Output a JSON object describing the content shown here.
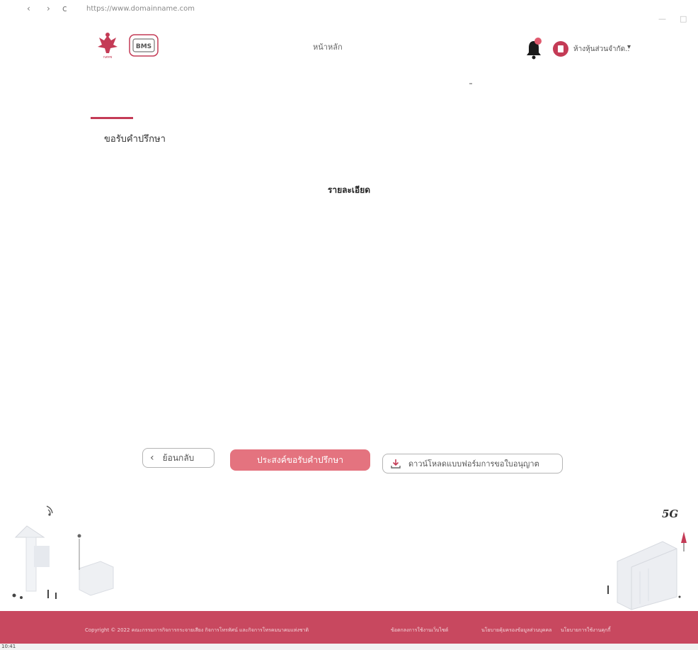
{
  "browser": {
    "back_glyph": "‹",
    "forward_glyph": "›",
    "reload_glyph": "c",
    "url": "https://www.domainname.com",
    "minimize_glyph": "—",
    "restore_glyph": "□"
  },
  "header": {
    "nav_home": "หน้าหลัก",
    "user_name": "ห้างหุ้นส่วนจำกัด..",
    "user_caret": "▾",
    "notification_dot_color": "#e05a6e",
    "logo_left_text": "กสทช",
    "logo_right_text": "BMS"
  },
  "page": {
    "title": "ขอรับคำปรึกษา",
    "section_heading": "รายละเอียด"
  },
  "actions": {
    "back_glyph": "‹",
    "back_label": "ย้อนกลับ",
    "submit_label": "ประสงค์ขอรับคำปรึกษา",
    "download_label": "ดาวน์โหลดแบบฟอร์มการขอใบอนุญาต"
  },
  "scene": {
    "signal_label": "5G"
  },
  "footer": {
    "copyright": "Copyright © 2022 คณะกรรมการกิจการกระจายเสียง กิจการโทรทัศน์ และกิจการโทรคมนาคมแห่งชาติ",
    "links": [
      "ข้อตกลงการใช้งานเว็บไซต์",
      "นโยบายคุ้มครองข้อมูลส่วนบุคคล",
      "นโยบายการใช้งานคุกกี้"
    ]
  },
  "taskbar": {
    "time": "10:41"
  },
  "colors": {
    "accent": "#c43b56",
    "primary_button": "#e4737f",
    "footer_background": "#c8485f"
  }
}
